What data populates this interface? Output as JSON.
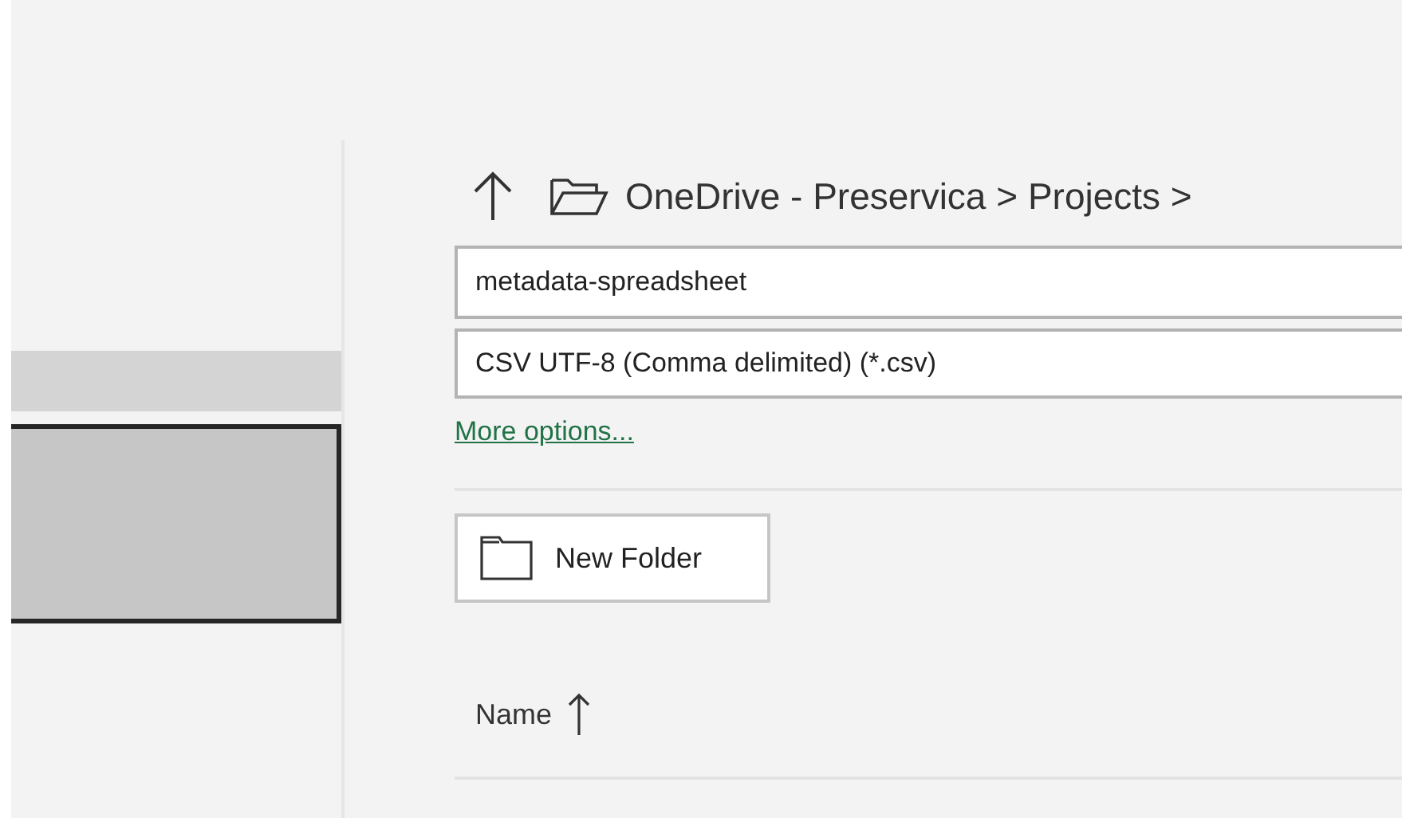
{
  "nav_items": [
    {
      "selected": false
    },
    {
      "selected": true
    }
  ],
  "breadcrumb": "OneDrive - Preservica > Projects >",
  "file_name": {
    "value": "metadata-spreadsheet"
  },
  "file_type": {
    "value": "CSV UTF-8 (Comma delimited) (*.csv)"
  },
  "more_options": "More options...",
  "new_folder_button": "New Folder",
  "columns": [
    {
      "label": "Name",
      "sorted": true
    }
  ]
}
